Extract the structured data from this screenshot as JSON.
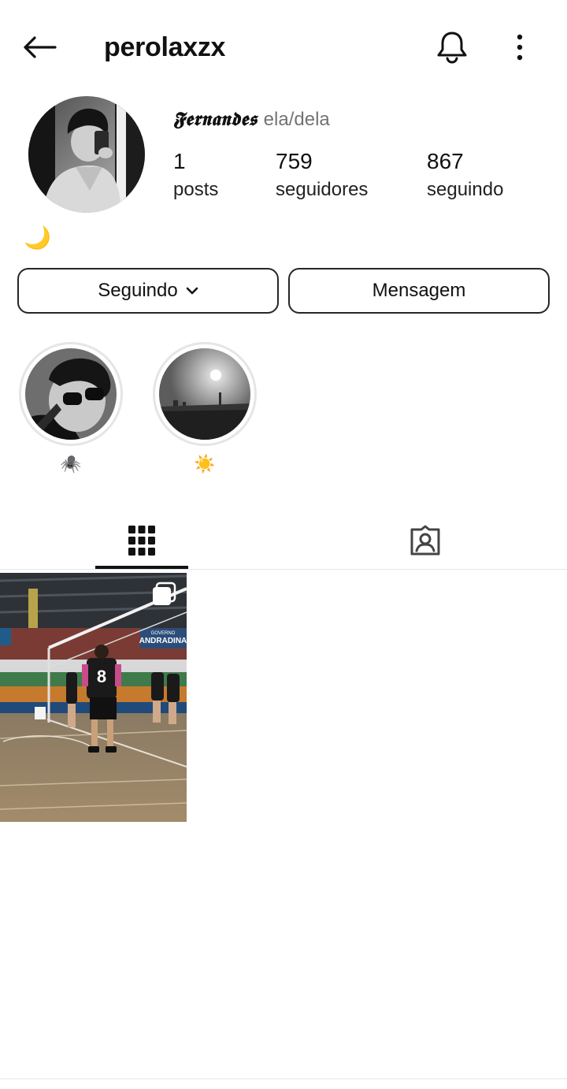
{
  "header": {
    "username": "perolaxzx",
    "icons": {
      "back": "arrow-left-icon",
      "notifications": "bell-icon",
      "more": "more-vertical-icon"
    }
  },
  "profile": {
    "display_name": "𝕱𝖊𝖗𝖓𝖆𝖓𝖉𝖊𝖘",
    "pronouns": "ela/dela",
    "bio": "🌙"
  },
  "stats": {
    "posts": {
      "value": "1",
      "label": "posts"
    },
    "followers": {
      "value": "759",
      "label": "seguidores"
    },
    "following": {
      "value": "867",
      "label": "seguindo"
    }
  },
  "actions": {
    "following_label": "Seguindo",
    "message_label": "Mensagem"
  },
  "highlights": [
    {
      "label": "🕷️"
    },
    {
      "label": "☀️"
    }
  ],
  "tabs": [
    {
      "icon": "grid-icon",
      "active": true
    },
    {
      "icon": "tagged-person-icon",
      "active": false
    }
  ],
  "posts": [
    {
      "type": "carousel",
      "jersey_number": "8",
      "banner_text_small": "GOVERNO",
      "banner_text": "ANDRADINA"
    }
  ],
  "colors": {
    "text": "#111111",
    "secondary_text": "#737373",
    "border": "#262626",
    "ring": "#e3e6e8"
  }
}
